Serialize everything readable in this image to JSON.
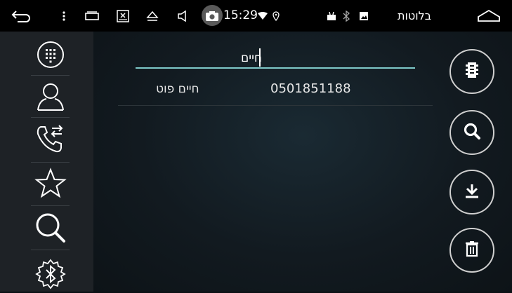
{
  "statusbar": {
    "time": "15:29",
    "app_title": "בלוטות"
  },
  "search": {
    "query": "חיים"
  },
  "results": [
    {
      "name": "חיים פוט",
      "number": "0501851188"
    }
  ],
  "left_rail": {
    "items": [
      "dialpad-icon",
      "contacts-icon",
      "call-log-icon",
      "favorites-icon",
      "search-icon",
      "bluetooth-settings-icon"
    ]
  },
  "actions": [
    "sync-phonebook-icon",
    "search-icon",
    "download-icon",
    "delete-icon"
  ],
  "colors": {
    "statusbar_bg": "#000000",
    "rail_bg": "#1e2226",
    "accent_line": "#7ec9c9"
  }
}
